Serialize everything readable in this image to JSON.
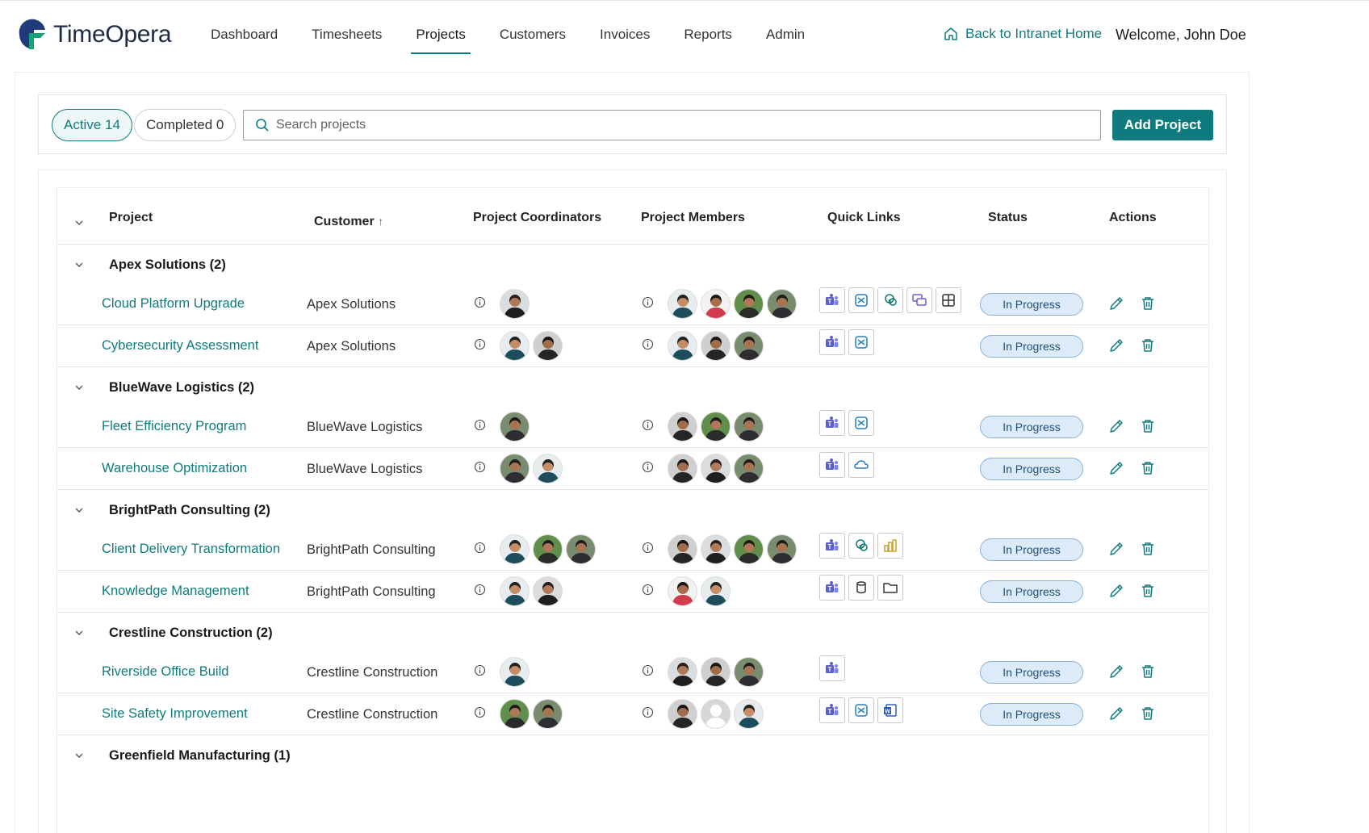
{
  "app": {
    "name": "TimeOpera"
  },
  "nav": {
    "items": [
      "Dashboard",
      "Timesheets",
      "Projects",
      "Customers",
      "Invoices",
      "Reports",
      "Admin"
    ],
    "active": "Projects"
  },
  "header": {
    "back_link": "Back to Intranet Home",
    "welcome": "Welcome, John Doe"
  },
  "filters": {
    "active_label": "Active 14",
    "completed_label": "Completed 0",
    "search_placeholder": "Search projects",
    "add_button": "Add Project"
  },
  "columns": {
    "project": "Project",
    "customer": "Customer",
    "customer_sort": "↑",
    "coordinators": "Project Coordinators",
    "members": "Project Members",
    "quick_links": "Quick Links",
    "status": "Status",
    "actions": "Actions"
  },
  "groups": [
    {
      "title": "Apex Solutions (2)",
      "rows": [
        {
          "project": "Cloud Platform Upgrade",
          "customer": "Apex Solutions",
          "coordinators": [
            "woman"
          ],
          "members": [
            "man",
            "man-red",
            "man-green",
            "man-suit"
          ],
          "links": [
            "teams",
            "exchange",
            "sharepoint",
            "chat",
            "planner"
          ],
          "status": "In Progress"
        },
        {
          "project": "Cybersecurity Assessment",
          "customer": "Apex Solutions",
          "coordinators": [
            "man",
            "man-dark"
          ],
          "members": [
            "man",
            "man-dark",
            "man-suit"
          ],
          "links": [
            "teams",
            "exchange"
          ],
          "status": "In Progress"
        }
      ]
    },
    {
      "title": "BlueWave Logistics (2)",
      "rows": [
        {
          "project": "Fleet Efficiency Program",
          "customer": "BlueWave Logistics",
          "coordinators": [
            "man-suit"
          ],
          "members": [
            "man-dark",
            "man-green",
            "man-suit"
          ],
          "links": [
            "teams",
            "exchange"
          ],
          "status": "In Progress"
        },
        {
          "project": "Warehouse Optimization",
          "customer": "BlueWave Logistics",
          "coordinators": [
            "man-suit",
            "man"
          ],
          "members": [
            "man-dark",
            "woman",
            "man-suit"
          ],
          "links": [
            "teams",
            "onedrive"
          ],
          "status": "In Progress"
        }
      ]
    },
    {
      "title": "BrightPath Consulting (2)",
      "rows": [
        {
          "project": "Client Delivery Transformation",
          "customer": "BrightPath Consulting",
          "coordinators": [
            "man",
            "man-green",
            "man-suit"
          ],
          "members": [
            "man-dark",
            "woman",
            "man-green",
            "man-suit"
          ],
          "links": [
            "teams",
            "sharepoint",
            "powerbi"
          ],
          "status": "In Progress"
        },
        {
          "project": "Knowledge Management",
          "customer": "BrightPath Consulting",
          "coordinators": [
            "man",
            "woman"
          ],
          "members": [
            "man-red",
            "man"
          ],
          "links": [
            "teams",
            "database",
            "folder"
          ],
          "status": "In Progress"
        }
      ]
    },
    {
      "title": "Crestline Construction (2)",
      "rows": [
        {
          "project": "Riverside Office Build",
          "customer": "Crestline Construction",
          "coordinators": [
            "man"
          ],
          "members": [
            "woman",
            "man-dark",
            "man-suit"
          ],
          "links": [
            "teams"
          ],
          "status": "In Progress"
        },
        {
          "project": "Site Safety Improvement",
          "customer": "Crestline Construction",
          "coordinators": [
            "man-green",
            "man-suit"
          ],
          "members": [
            "man-dark",
            "placeholder",
            "man"
          ],
          "links": [
            "teams",
            "exchange",
            "word"
          ],
          "status": "In Progress"
        }
      ]
    },
    {
      "title": "Greenfield Manufacturing (1)",
      "rows": []
    }
  ]
}
